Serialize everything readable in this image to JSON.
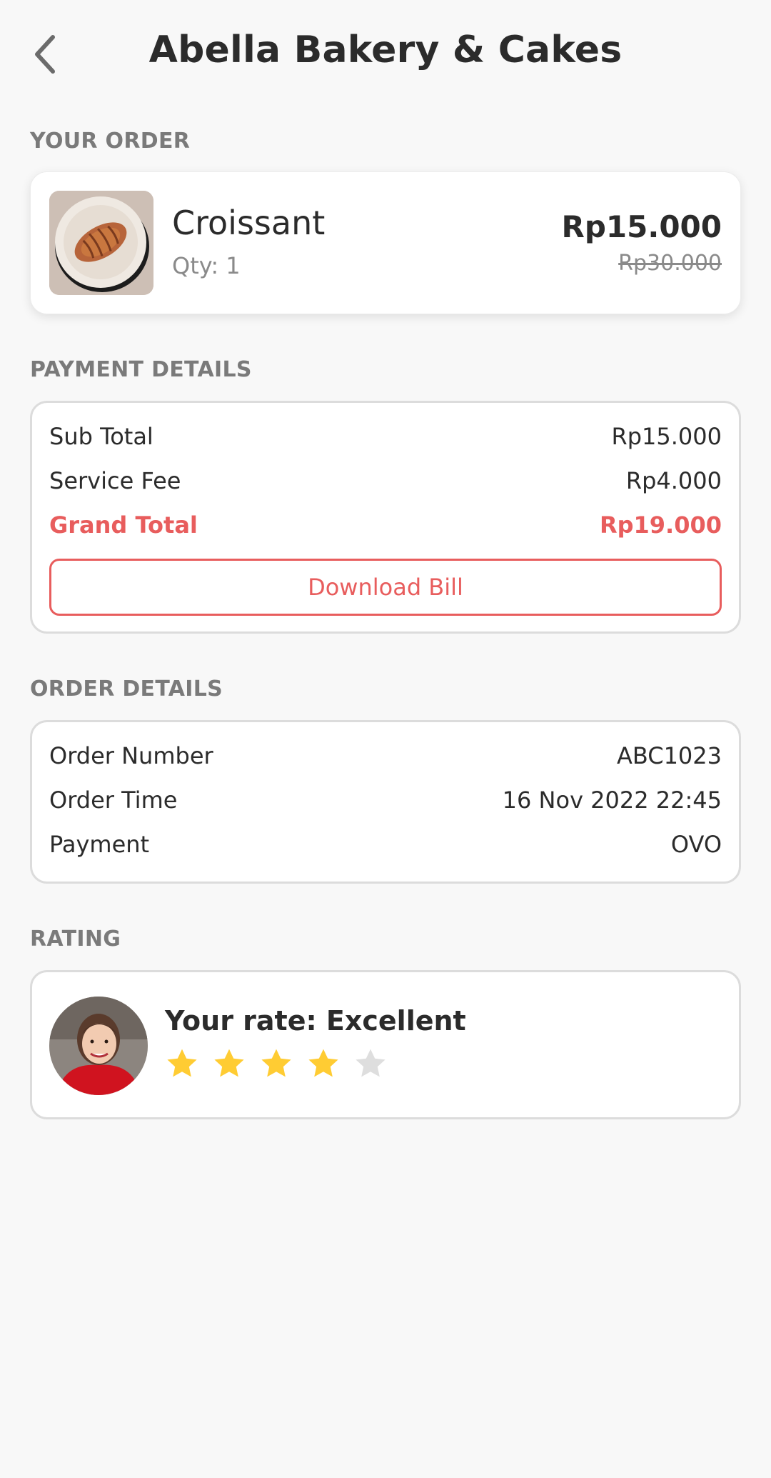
{
  "header": {
    "title": "Abella Bakery & Cakes",
    "back_icon": "chevron-left-icon"
  },
  "your_order": {
    "label": "YOUR ORDER",
    "item": {
      "name": "Croissant",
      "qty": "Qty: 1",
      "price": "Rp15.000",
      "original_price": "Rp30.000"
    }
  },
  "payment": {
    "label": "PAYMENT DETAILS",
    "sub_total": {
      "label": "Sub Total",
      "value": "Rp15.000"
    },
    "service_fee": {
      "label": "Service Fee",
      "value": "Rp4.000"
    },
    "grand_total": {
      "label": "Grand Total",
      "value": "Rp19.000"
    },
    "download_label": "Download Bill"
  },
  "order_details": {
    "label": "ORDER DETAILS",
    "order_number": {
      "label": "Order Number",
      "value": "ABC1023"
    },
    "order_time": {
      "label": "Order Time",
      "value": "16 Nov 2022 22:45"
    },
    "payment": {
      "label": "Payment",
      "value": "OVO"
    }
  },
  "rating": {
    "label": "RATING",
    "text": "Your rate: Excellent",
    "stars_filled": 4,
    "stars_total": 5
  },
  "colors": {
    "accent": "#e85d5d",
    "star_on": "#ffcc33",
    "star_off": "#dedede"
  }
}
